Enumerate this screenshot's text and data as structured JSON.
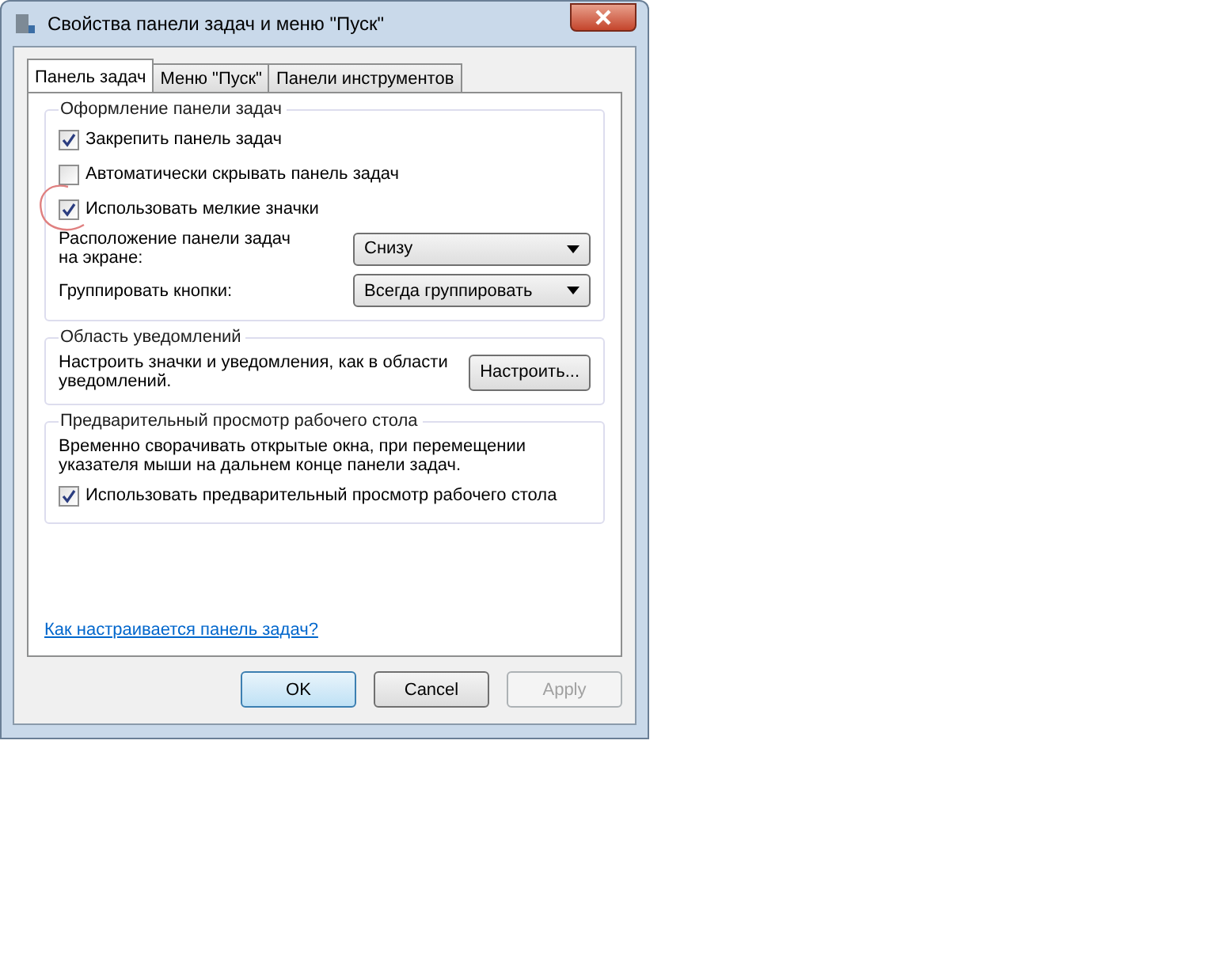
{
  "window": {
    "title": "Свойства панели задач и меню \"Пуск\""
  },
  "tabs": [
    {
      "label": "Панель задач",
      "selected": true
    },
    {
      "label": "Меню \"Пуск\"",
      "selected": false
    },
    {
      "label": "Панели инструментов",
      "selected": false
    }
  ],
  "appearance": {
    "title": "Оформление панели задач",
    "checkboxes": [
      {
        "label": "Закрепить панель задач",
        "checked": true,
        "circled": false
      },
      {
        "label": "Автоматически скрывать панель задач",
        "checked": false,
        "circled": false
      },
      {
        "label": "Использовать мелкие значки",
        "checked": true,
        "circled": true
      }
    ],
    "dropdowns": [
      {
        "label": "Расположение панели задач на экране:",
        "value": "Снизу"
      },
      {
        "label": "Группировать кнопки:",
        "value": "Всегда группировать"
      }
    ]
  },
  "notifications": {
    "title": "Область уведомлений",
    "text": "Настроить значки и уведомления, как в области уведомлений.",
    "button": "Настроить..."
  },
  "peek": {
    "title": "Предварительный просмотр рабочего стола",
    "text": "Временно сворачивать открытые окна, при перемещении указателя мыши на дальнем конце панели задач.",
    "checkbox": {
      "label": "Использовать предварительный просмотр рабочего стола",
      "checked": true,
      "circled": false
    }
  },
  "help_link": "Как настраивается панель задач?",
  "buttons": [
    {
      "label": "OK",
      "kind": "default",
      "disabled": false
    },
    {
      "label": "Cancel",
      "kind": "normal",
      "disabled": false
    },
    {
      "label": "Apply",
      "kind": "normal",
      "disabled": true
    }
  ]
}
